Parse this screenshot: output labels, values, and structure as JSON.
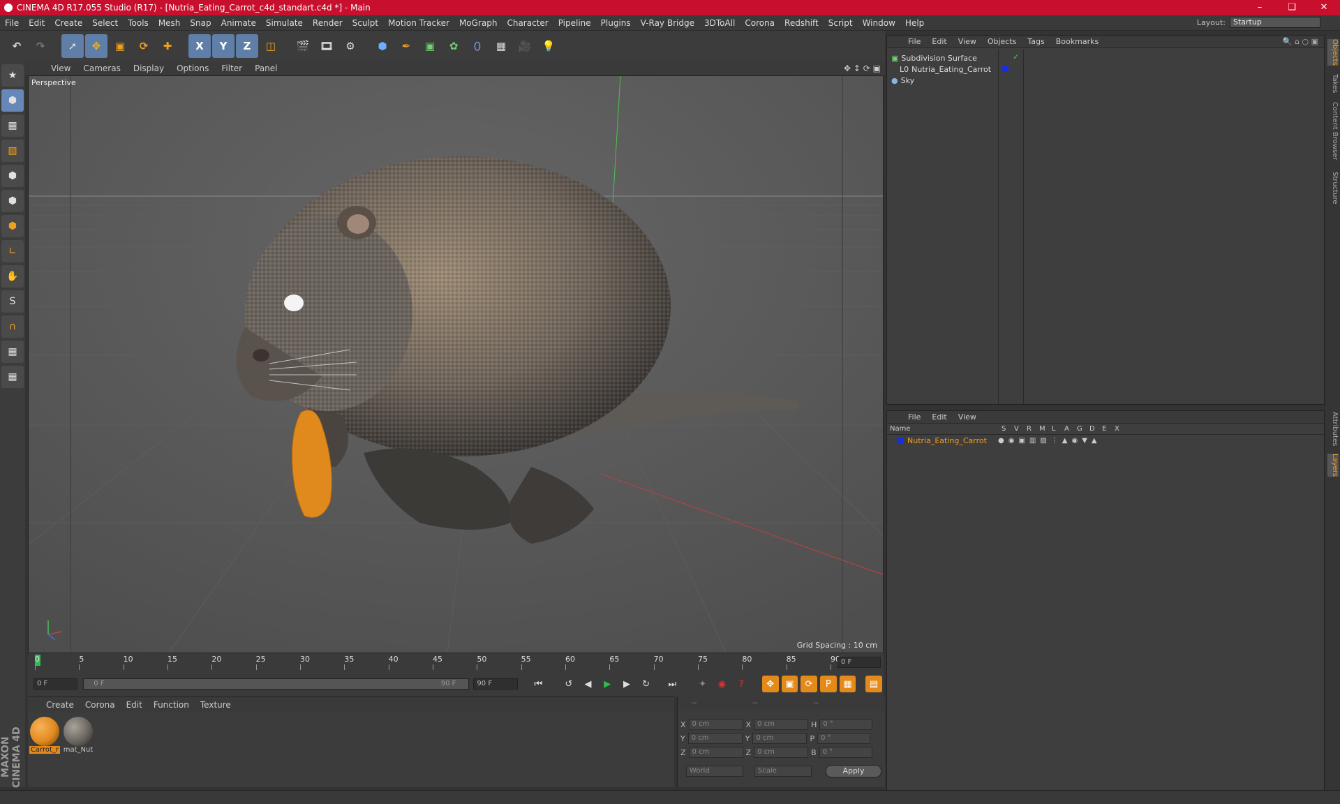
{
  "window": {
    "title": "CINEMA 4D R17.055 Studio (R17) - [Nutria_Eating_Carrot_c4d_standart.c4d *] - Main",
    "min": "–",
    "max": "❏",
    "close": "✕"
  },
  "menu": [
    "File",
    "Edit",
    "Create",
    "Select",
    "Tools",
    "Mesh",
    "Snap",
    "Animate",
    "Simulate",
    "Render",
    "Sculpt",
    "Motion Tracker",
    "MoGraph",
    "Character",
    "Pipeline",
    "Plugins",
    "V-Ray Bridge",
    "3DToAll",
    "Corona",
    "Redshift",
    "Script",
    "Window",
    "Help"
  ],
  "layout": {
    "label": "Layout:",
    "value": "Startup"
  },
  "toolbar": {
    "x": "X",
    "y": "Y",
    "z": "Z"
  },
  "viewport": {
    "menu": [
      "View",
      "Cameras",
      "Display",
      "Options",
      "Filter",
      "Panel"
    ],
    "label": "Perspective",
    "grid_spacing": "Grid Spacing : 10 cm"
  },
  "timeline": {
    "ticks": [
      "0",
      "5",
      "10",
      "15",
      "20",
      "25",
      "30",
      "35",
      "40",
      "45",
      "50",
      "55",
      "60",
      "65",
      "70",
      "75",
      "80",
      "85",
      "90"
    ],
    "current_frame": "0 F"
  },
  "transport": {
    "start": "0 F",
    "range_start": "0 F",
    "range_end": "90 F",
    "end": "90 F"
  },
  "materials": {
    "menu": [
      "Create",
      "Corona",
      "Edit",
      "Function",
      "Texture"
    ],
    "items": [
      {
        "name": "Carrot_r",
        "color": "#e08a1e"
      },
      {
        "name": "mat_Nut",
        "color": "#6a6660"
      }
    ]
  },
  "coords": {
    "headers": [
      "--",
      "--",
      "--"
    ],
    "rows": [
      {
        "a": "X",
        "av": "0 cm",
        "b": "X",
        "bv": "0 cm",
        "c": "H",
        "cv": "0 °"
      },
      {
        "a": "Y",
        "av": "0 cm",
        "b": "Y",
        "bv": "0 cm",
        "c": "P",
        "cv": "0 °"
      },
      {
        "a": "Z",
        "av": "0 cm",
        "b": "Z",
        "bv": "0 cm",
        "c": "B",
        "cv": "0 °"
      }
    ],
    "world": "World",
    "scale": "Scale",
    "apply": "Apply"
  },
  "objects": {
    "menu": [
      "File",
      "Edit",
      "View",
      "Objects",
      "Tags",
      "Bookmarks"
    ],
    "items": [
      {
        "name": "Subdivision Surface"
      },
      {
        "name": "Nutria_Eating_Carrot"
      },
      {
        "name": "Sky"
      }
    ]
  },
  "layers": {
    "menu": [
      "File",
      "Edit",
      "View"
    ],
    "columns": [
      "Name",
      "S",
      "V",
      "R",
      "M",
      "L",
      "A",
      "G",
      "D",
      "E",
      "X"
    ],
    "row": "Nutria_Eating_Carrot"
  },
  "right_tabs": [
    "Objects",
    "Takes",
    "Content Browser",
    "Structure",
    "Attributes",
    "Layers"
  ],
  "brand": "MAXON CINEMA 4D",
  "colors": {
    "accent": "#c8102e",
    "selection": "#e38a1b"
  }
}
